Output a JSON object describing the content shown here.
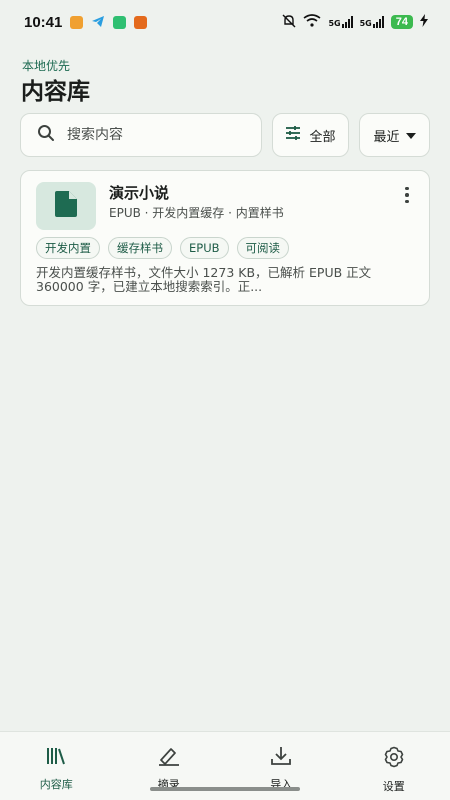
{
  "status_bar": {
    "time": "10:41",
    "battery": "74",
    "net1": "5G",
    "net2": "5G"
  },
  "header": {
    "subtitle": "本地优先",
    "title": "内容库"
  },
  "search": {
    "placeholder": "搜索内容"
  },
  "filter": {
    "label": "全部"
  },
  "sort": {
    "label": "最近"
  },
  "items": [
    {
      "title": "演示小说",
      "meta": "EPUB · 开发内置缓存 · 内置样书",
      "tags": [
        "开发内置",
        "缓存样书",
        "EPUB",
        "可阅读"
      ],
      "description": "开发内置缓存样书，文件大小 1273 KB，已解析 EPUB 正文 360000 字，已建立本地搜索索引。正..."
    }
  ],
  "nav": [
    {
      "label": "内容库",
      "icon": "library-icon"
    },
    {
      "label": "摘录",
      "icon": "highlighter-icon"
    },
    {
      "label": "导入",
      "icon": "download-icon"
    },
    {
      "label": "设置",
      "icon": "settings-gear-icon"
    }
  ],
  "colors": {
    "accent": "#1e6b52",
    "background": "#eef2ee",
    "card": "#fbfcf9"
  }
}
